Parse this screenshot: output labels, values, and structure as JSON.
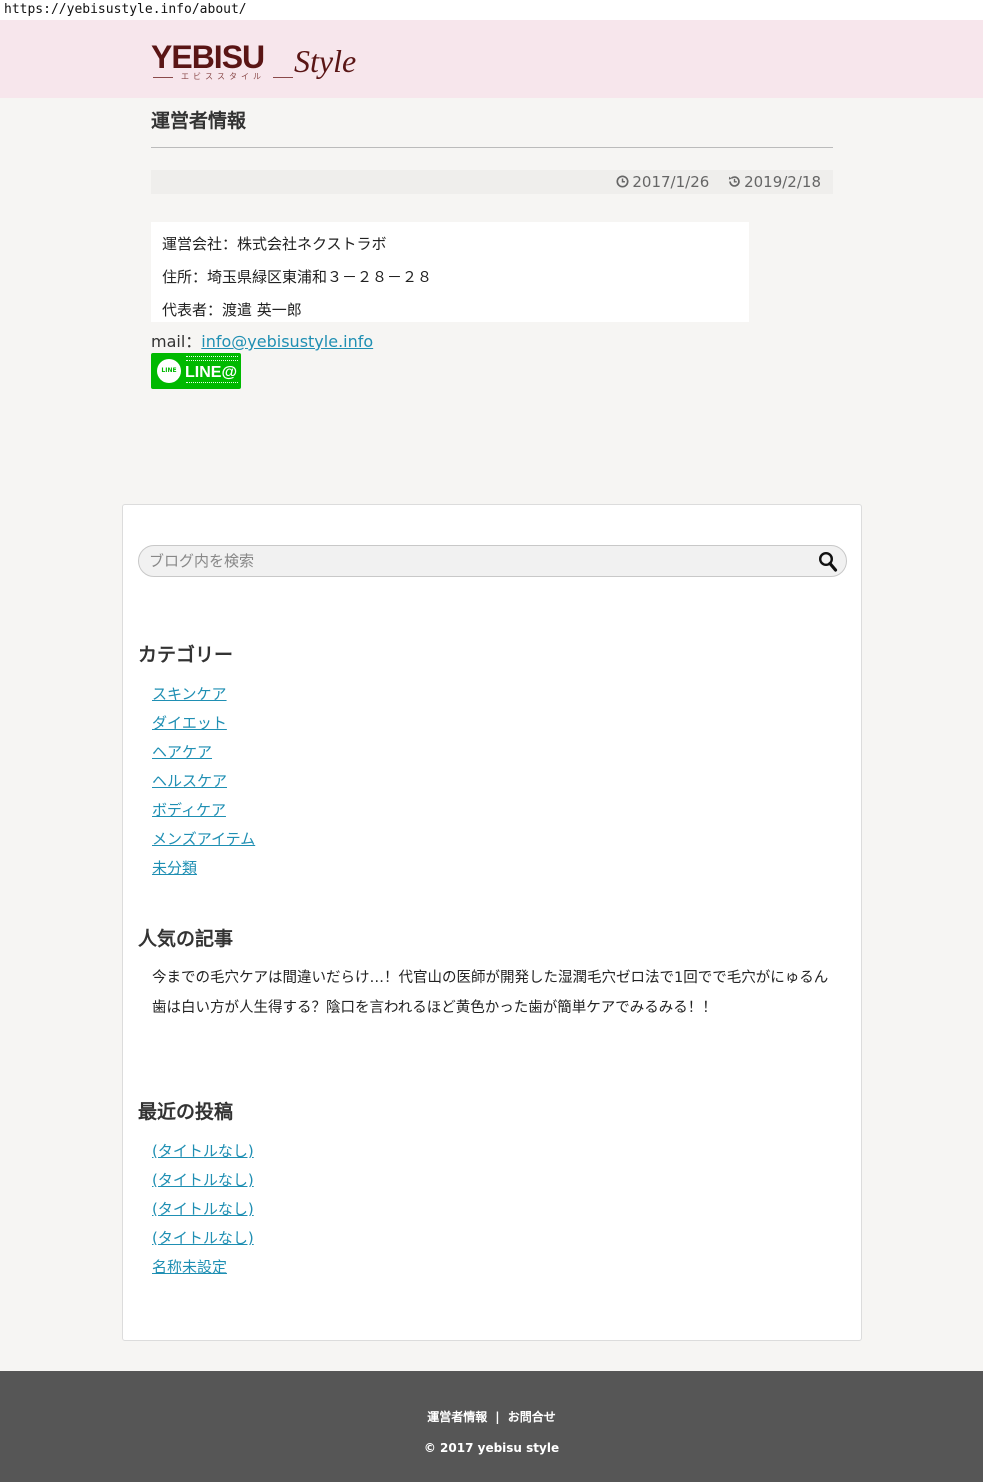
{
  "browser": {
    "url": "https://yebisustyle.info/about/"
  },
  "header": {
    "logo_main": "YEBISU",
    "logo_script": "Style",
    "logo_sub": "エビススタイル"
  },
  "article": {
    "title": "運営者情報",
    "published": "2017/1/26",
    "updated": "2019/2/18",
    "info_lines": [
      "運営会社：株式会社ネクストラボ",
      "住所：埼玉県緑区東浦和３－２８－２８",
      "代表者：渡遣 英一郎"
    ],
    "mail_label": "mail：",
    "mail_link": "info@yebisustyle.info",
    "line_badge": "LINE@"
  },
  "sidebar": {
    "search_placeholder": "ブログ内を検索",
    "categories_title": "カテゴリー",
    "categories": [
      "スキンケア",
      "ダイエット",
      "ヘアケア",
      "ヘルスケア",
      "ボディケア",
      "メンズアイテム",
      "未分類"
    ],
    "popular_title": "人気の記事",
    "popular": [
      "今までの毛穴ケアは間違いだらけ…！代官山の医師が開発した湿潤毛穴ゼロ法で1回でで毛穴がにゅるん",
      "歯は白い方が人生得する？陰口を言われるほど黄色かった歯が簡単ケアでみるみる！！"
    ],
    "recent_title": "最近の投稿",
    "recent": [
      "(タイトルなし)",
      "(タイトルなし)",
      "(タイトルなし)",
      "(タイトルなし)",
      "名称未設定"
    ]
  },
  "footer": {
    "nav_about": "運営者情報",
    "nav_sep": "|",
    "nav_contact": "お問合せ",
    "copyright": "© 2017 yebisu style"
  },
  "colors": {
    "header_bg": "#f7e6ec",
    "logo": "#5a1515",
    "link": "#1f8fb3",
    "footer_bg": "#565656",
    "line_green": "#00b900"
  },
  "icons": [
    "clock-icon",
    "history-icon",
    "search-icon",
    "line-logo-icon"
  ]
}
